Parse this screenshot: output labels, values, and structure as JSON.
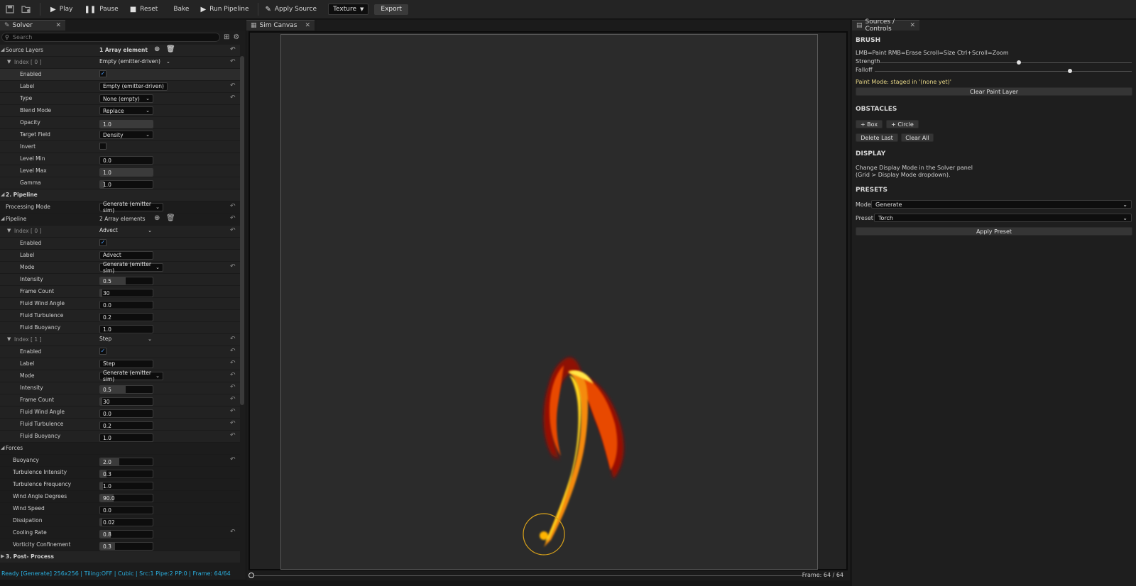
{
  "toolbar": {
    "play": "Play",
    "pause": "Pause",
    "reset": "Reset",
    "bake": "Bake",
    "run_pipeline": "Run Pipeline",
    "apply_source": "Apply Source",
    "texture": "Texture",
    "export": "Export"
  },
  "left": {
    "tab_title": "Solver",
    "search_placeholder": "Search",
    "source_layers": {
      "label": "Source Layers",
      "count": "1 Array element",
      "index0": {
        "label": "Index [ 0 ]",
        "value": "Empty (emitter-driven)",
        "props": {
          "enabled": "Enabled",
          "label": "Label",
          "label_value": "Empty (emitter-driven)",
          "type": "Type",
          "type_value": "None (empty)",
          "blend": "Blend Mode",
          "blend_value": "Replace",
          "opacity": "Opacity",
          "opacity_value": "1.0",
          "target": "Target Field",
          "target_value": "Density",
          "invert": "Invert",
          "lmin": "Level Min",
          "lmin_value": "0.0",
          "lmax": "Level Max",
          "lmax_value": "1.0",
          "gamma": "Gamma",
          "gamma_value": "1.0"
        }
      }
    },
    "pipeline_section": "2. Pipeline",
    "processing_mode": "Processing Mode",
    "processing_mode_value": "Generate (emitter sim)",
    "pipeline": {
      "label": "Pipeline",
      "count": "2 Array elements",
      "items": [
        {
          "index": "Index [ 0 ]",
          "value": "Advect",
          "enabled": "Enabled",
          "label": "Label",
          "label_value": "Advect",
          "mode": "Mode",
          "mode_value": "Generate (emitter sim)",
          "intensity": "Intensity",
          "intensity_value": "0.5",
          "frame_count": "Frame Count",
          "frame_count_value": "30",
          "wind_angle": "Fluid Wind Angle",
          "wind_angle_value": "0.0",
          "turbulence": "Fluid Turbulence",
          "turbulence_value": "0.2",
          "buoyancy": "Fluid Buoyancy",
          "buoyancy_value": "1.0"
        },
        {
          "index": "Index [ 1 ]",
          "value": "Step",
          "enabled": "Enabled",
          "label": "Label",
          "label_value": "Step",
          "mode": "Mode",
          "mode_value": "Generate (emitter sim)",
          "intensity": "Intensity",
          "intensity_value": "0.5",
          "frame_count": "Frame Count",
          "frame_count_value": "30",
          "wind_angle": "Fluid Wind Angle",
          "wind_angle_value": "0.0",
          "turbulence": "Fluid Turbulence",
          "turbulence_value": "0.2",
          "buoyancy": "Fluid Buoyancy",
          "buoyancy_value": "1.0"
        }
      ]
    },
    "forces": {
      "label": "Forces",
      "buoyancy": "Buoyancy",
      "buoyancy_value": "2.0",
      "turb_int": "Turbulence Intensity",
      "turb_int_value": "0.3",
      "turb_freq": "Turbulence Frequency",
      "turb_freq_value": "1.0",
      "wind_angle": "Wind Angle Degrees",
      "wind_angle_value": "90.0",
      "wind_speed": "Wind Speed",
      "wind_speed_value": "0.0",
      "dissipation": "Dissipation",
      "dissipation_value": "0.02",
      "cooling": "Cooling Rate",
      "cooling_value": "0.8",
      "vorticity": "Vorticity Confinement",
      "vorticity_value": "0.3"
    },
    "post_section": "3. Post- Process",
    "status": "Ready [Generate] 256x256 | Tiling:OFF | Cubic | Src:1 Pipe:2 PP:0 | Frame: 64/64"
  },
  "center": {
    "tab_title": "Sim Canvas",
    "frame_label": "Frame: 64 / 64"
  },
  "right": {
    "tab_title": "Sources / Controls",
    "brush": {
      "title": "BRUSH",
      "hint": "LMB=Paint  RMB=Erase  Scroll=Size  Ctrl+Scroll=Zoom",
      "strength": "Strength",
      "strength_level": 0.56,
      "falloff": "Falloff",
      "falloff_level": 0.76,
      "paint_mode": "Paint Mode: staged in '(none yet)'",
      "clear_paint": "Clear Paint Layer"
    },
    "obstacles": {
      "title": "OBSTACLES",
      "box": "+ Box",
      "circle": "+ Circle",
      "delete_last": "Delete Last",
      "clear_all": "Clear All"
    },
    "display": {
      "title": "DISPLAY",
      "line1": "Change Display Mode in the Solver panel",
      "line2": "(Grid > Display Mode dropdown)."
    },
    "presets": {
      "title": "PRESETS",
      "mode": "Mode",
      "mode_value": "Generate",
      "preset": "Preset",
      "preset_value": "Torch",
      "apply": "Apply Preset"
    }
  },
  "colors": {
    "accent_blue": "#4ea0ff",
    "status_cyan": "#2ab0e0",
    "paint_mode_yellow": "#e8d888",
    "brush_ring": "#d9a21a"
  }
}
